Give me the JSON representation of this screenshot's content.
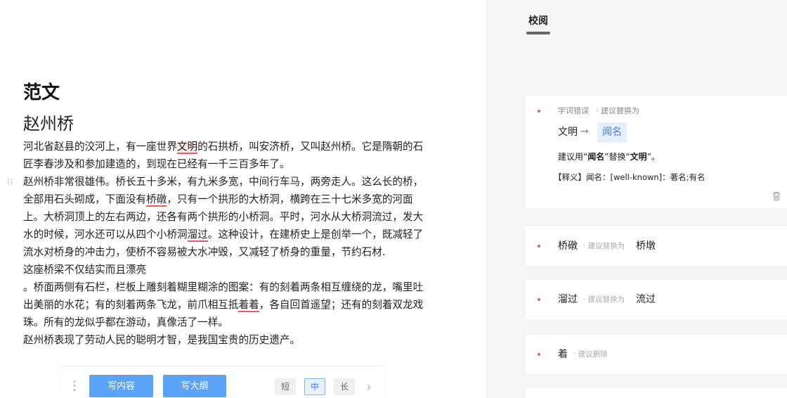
{
  "editor": {
    "title": "范文",
    "subtitle": "赵州桥",
    "p1": [
      {
        "t": "河北省赵县的洨河上，有一座世界"
      },
      {
        "t": "文明",
        "mark": "box"
      },
      {
        "t": "的石拱桥，叫安济桥，又叫赵州桥。它是隋朝的石匠李春涉及和参加建造的，到现在已经有一千三百多年了。"
      }
    ],
    "p2": [
      {
        "t": "赵州桥非常很雄伟。桥长五十多米，有九米多宽，中间行车马，两旁走人。这么长的桥，全部用石头砌成，下面没有"
      },
      {
        "t": "桥礅",
        "mark": "line"
      },
      {
        "t": "，只有一个拱形的大桥洞，横跨在三十七米多宽的河面上。大桥洞顶上的左右两边，还各有两个拱形的小桥洞。平时，河水从大桥洞流过，发大水的时候，河水还可以从四个小桥洞"
      },
      {
        "t": "溜过",
        "mark": "line"
      },
      {
        "t": "。这种设计，在建桥史上是创举一个，既减轻了流水对桥身的冲击力，使桥不容易被大水冲毁，又减轻了桥身的重量，节约石材."
      }
    ],
    "p3": [
      {
        "t": "这座桥梁不仅结实而且漂亮"
      }
    ],
    "p4": [
      {
        "t": "。桥面两侧有石栏，栏板上雕刻着糊里糊涂的图案：有的刻着两条相互缠绕的龙，嘴里吐出美丽的水花；有的刻着两条飞龙，前爪相互抵"
      },
      {
        "t": "着着",
        "mark": "line"
      },
      {
        "t": "，各自回首遥望；还有的刻着双龙戏珠。所有的龙似乎都在游动，真像活了一样。"
      }
    ],
    "p5": [
      {
        "t": "赵州桥表现了劳动人民的聪明才智，是我国宝贵的历史遗产。"
      }
    ]
  },
  "toolbar": {
    "write_content": "写内容",
    "write_outline": "写大纲",
    "len_short": "短",
    "len_mid": "中",
    "len_long": "长",
    "selected_length": "中"
  },
  "review": {
    "tab_label": "校阅",
    "card1": {
      "type": "字词错误",
      "hint": "· 建议替换为",
      "original": "文明",
      "arrow": "→",
      "suggestion": "闻名",
      "advice_pre": "建议用“",
      "advice_new": "闻名",
      "advice_mid": "”替换“",
      "advice_old": "文明",
      "advice_post": "”。",
      "definition": "【释义】闻名：[well-known]：著名;有名"
    },
    "card2": {
      "original": "桥礅",
      "hint": "· 建议替换为",
      "suggestion": "桥墩"
    },
    "card3": {
      "original": "溜过",
      "hint": "· 建议替换为",
      "suggestion": "流过"
    },
    "card4": {
      "original": "着",
      "hint": "· 建议删除"
    }
  },
  "colors": {
    "accent": "#5ba3f7",
    "error": "#e85c5c",
    "suggestion_bg": "#e5efff"
  }
}
